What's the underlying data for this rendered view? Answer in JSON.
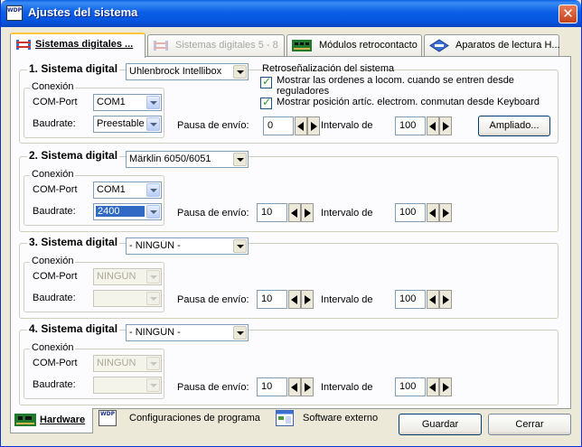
{
  "window": {
    "title": "Ajustes del sistema",
    "app_icon_text": "WDP"
  },
  "tabs": [
    {
      "label": "Sistemas digitales ...",
      "state": "active"
    },
    {
      "label": "Sistemas digitales 5 - 8",
      "state": "disabled"
    },
    {
      "label": "Módulos retrocontacto",
      "state": "normal"
    },
    {
      "label": "Aparatos de lectura H...",
      "state": "normal"
    }
  ],
  "systems": [
    {
      "title": "1. Sistema digital",
      "system_value": "Uhlenbrock Intellibox",
      "conexion_label": "Conexión",
      "com_label": "COM-Port",
      "com_value": "COM1",
      "baud_label": "Baudrate:",
      "baud_value": "Preestablec",
      "pause_label": "Pausa de envío:",
      "pause_value": "0",
      "interval_label": "Intervalo de",
      "interval_value": "100"
    },
    {
      "title": "2. Sistema digital",
      "system_value": "Märklin 6050/6051",
      "conexion_label": "Conexión",
      "com_label": "COM-Port",
      "com_value": "COM1",
      "baud_label": "Baudrate:",
      "baud_value": "2400",
      "pause_label": "Pausa de envío:",
      "pause_value": "10",
      "interval_label": "Intervalo de",
      "interval_value": "100"
    },
    {
      "title": "3. Sistema digital",
      "system_value": "- NINGÚN -",
      "conexion_label": "Conexión",
      "com_label": "COM-Port",
      "com_value": "NINGÚN",
      "baud_label": "Baudrate:",
      "baud_value": "",
      "pause_label": "Pausa de envío:",
      "pause_value": "10",
      "interval_label": "Intervalo de",
      "interval_value": "100"
    },
    {
      "title": "4. Sistema digital",
      "system_value": "- NINGÚN -",
      "conexion_label": "Conexión",
      "com_label": "COM-Port",
      "com_value": "NINGÚN",
      "baud_label": "Baudrate:",
      "baud_value": "",
      "pause_label": "Pausa de envío:",
      "pause_value": "10",
      "interval_label": "Intervalo de",
      "interval_value": "100"
    }
  ],
  "retro": {
    "title": "Retroseñalización del sistema",
    "check1_line1": "Mostrar las ordenes a locom. cuando se entren desde",
    "check1_line2": "reguladores",
    "check2": "Mostrar posición artíc. electrom. conmutan desde Keyboard",
    "ampliado": "Ampliado..."
  },
  "bottom_tabs": [
    {
      "label": "Hardware",
      "state": "active"
    },
    {
      "label": "Configuraciones de programa",
      "state": "normal",
      "icon_text": "WDP"
    },
    {
      "label": "Software externo",
      "state": "normal"
    }
  ],
  "buttons": {
    "save": "Guardar",
    "close": "Cerrar"
  },
  "colors": {
    "title_bar": "#0A5FE3",
    "selection": "#316AC5",
    "face": "#ECE9D8",
    "tab_highlight": "#FFC83C"
  }
}
